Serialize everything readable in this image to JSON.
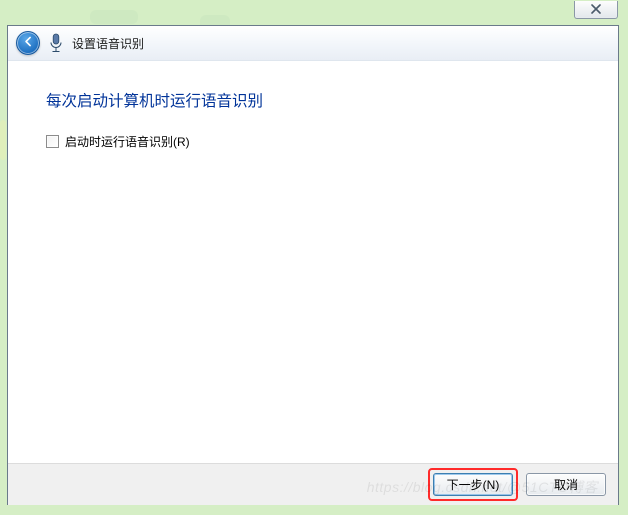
{
  "titlebar": {
    "close_tooltip": "Close"
  },
  "header": {
    "back_label": "Back",
    "title": "设置语音识别"
  },
  "body": {
    "heading": "每次启动计算机时运行语音识别",
    "checkbox_label": "启动时运行语音识别(R)"
  },
  "footer": {
    "next_label": "下一步(N)",
    "cancel_label": "取消"
  },
  "watermark": "https://blog.csdn.net/@51CTO博客"
}
